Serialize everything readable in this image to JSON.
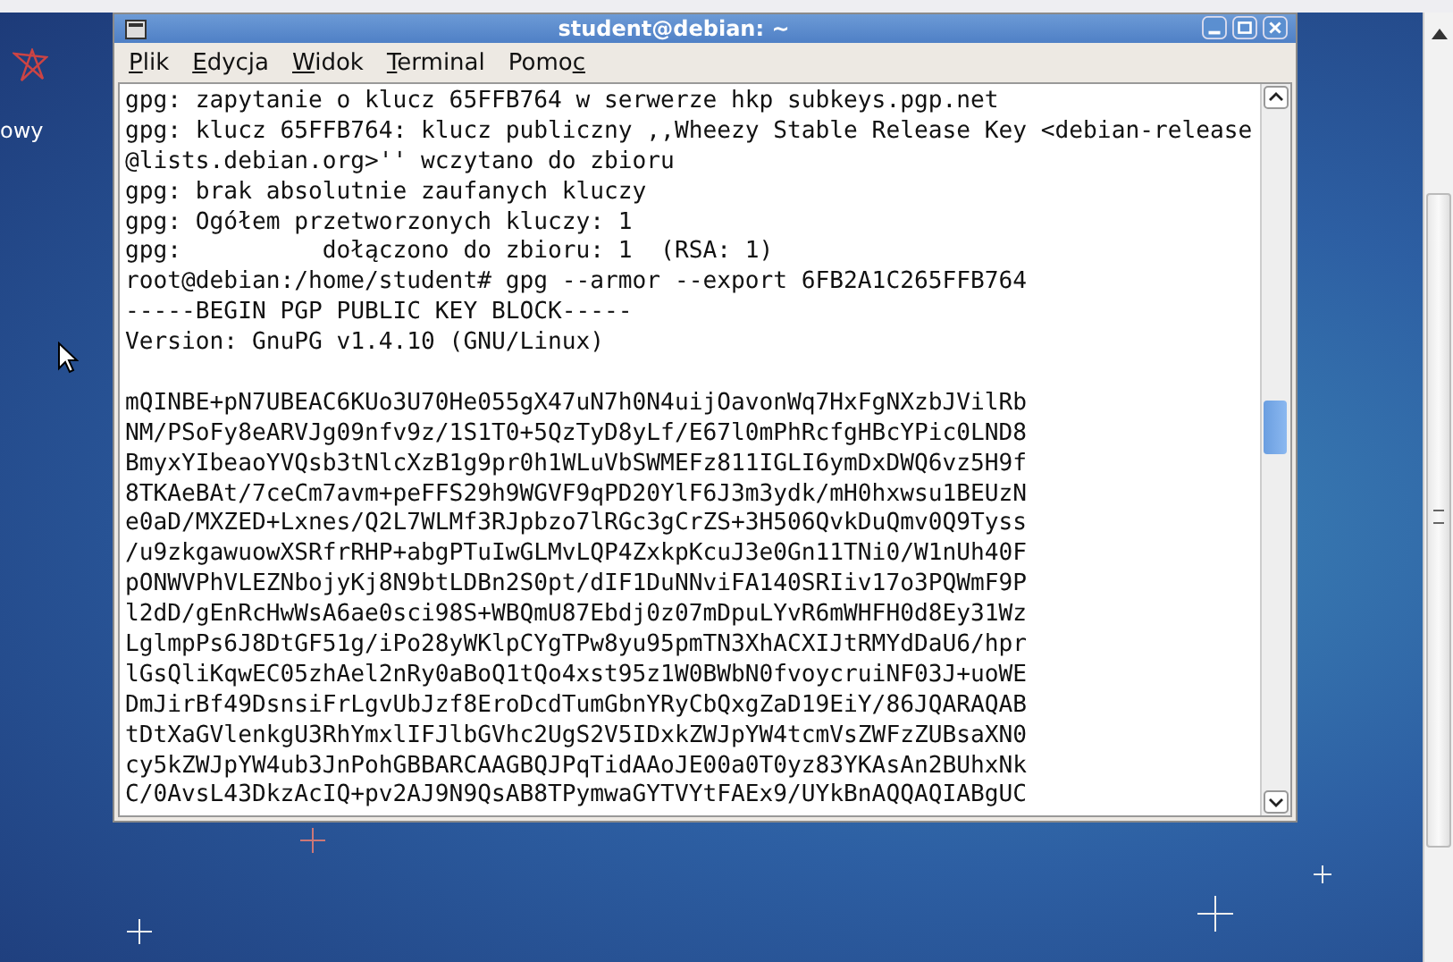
{
  "desktop": {
    "icon_label": "owy"
  },
  "window": {
    "title": "student@debian: ~"
  },
  "menu": [
    {
      "mnemonic": "P",
      "after": "lik"
    },
    {
      "mnemonic": "E",
      "after": "dycja"
    },
    {
      "mnemonic": "W",
      "after": "idok"
    },
    {
      "mnemonic": "T",
      "after": "erminal"
    },
    {
      "before": "Pomo",
      "mnemonic": "c"
    }
  ],
  "terminal_lines": [
    "gpg: zapytanie o klucz 65FFB764 w serwerze hkp subkeys.pgp.net",
    "gpg: klucz 65FFB764: klucz publiczny ,,Wheezy Stable Release Key <debian-release",
    "@lists.debian.org>'' wczytano do zbioru",
    "gpg: brak absolutnie zaufanych kluczy",
    "gpg: Ogółem przetworzonych kluczy: 1",
    "gpg:          dołączono do zbioru: 1  (RSA: 1)",
    "root@debian:/home/student# gpg --armor --export 6FB2A1C265FFB764",
    "-----BEGIN PGP PUBLIC KEY BLOCK-----",
    "Version: GnuPG v1.4.10 (GNU/Linux)"
  ],
  "key_block_lines": [
    "mQINBE+pN7UBEAC6KUo3U70He055gX47uN7h0N4uijOavonWq7HxFgNXzbJVilRb",
    "NM/PSoFy8eARVJg09nfv9z/1S1T0+5QzTyD8yLf/E67l0mPhRcfgHBcYPic0LND8",
    "BmyxYIbeaoYVQsb3tNlcXzB1g9pr0h1WLuVbSWMEFz811IGLI6ymDxDWQ6vz5H9f",
    "8TKAeBAt/7ceCm7avm+peFFS29h9WGVF9qPD20YlF6J3m3ydk/mH0hxwsu1BEUzN",
    "e0aD/MXZED+Lxnes/Q2L7WLMf3RJpbzo7lRGc3gCrZS+3H506QvkDuQmv0Q9Tyss",
    "/u9zkgawuowXSRfrRHP+abgPTuIwGLMvLQP4ZxkpKcuJ3e0Gn11TNi0/W1nUh40F",
    "pONWVPhVLEZNbojyKj8N9btLDBn2S0pt/dIF1DuNNviFA140SRIiv17o3PQWmF9P",
    "l2dD/gEnRcHwWsA6ae0sci98S+WBQmU87Ebdj0z07mDpuLYvR6mWHFH0d8Ey31Wz",
    "LglmpPs6J8DtGF51g/iPo28yWKlpCYgTPw8yu95pmTN3XhACXIJtRMYdDaU6/hpr",
    "lGsQliKqwEC05zhAel2nRy0aBoQ1tQo4xst95z1W0BWbN0fvoycruiNF03J+uoWE",
    "DmJirBf49DsnsiFrLgvUbJzf8EroDcdTumGbnYRyCbQxgZaD19EiY/86JQARAQAB",
    "tDtXaGVlenkgU3RhYmxlIFJlbGVhc2UgS2V5IDxkZWJpYW4tcmVsZWFzZUBsaXN0",
    "cy5kZWJpYW4ub3JnPohGBBARCAAGBQJPqTidAAoJE00a0T0yz83YKAsAn2BUhxNk",
    "C/0AvsL43DkzAcIQ+pv2AJ9N9QsAB8TPymwaGYTVYtFAEx9/UYkBnAQQAQIABgUC"
  ]
}
